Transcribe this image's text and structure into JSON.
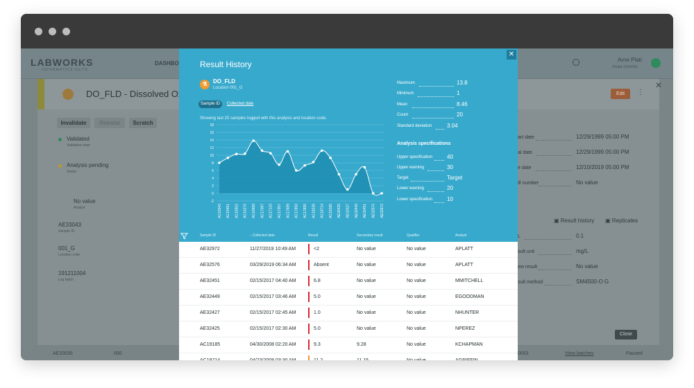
{
  "background_app": {
    "logo": "LABWORKS",
    "logo_sub": "INFORMATICS SUITE",
    "nav_item": "DASHBOA",
    "user_name": "Arne Platt",
    "user_role": "Head chemist",
    "panel_title": "DO_FLD - Dissolved Oxygen",
    "edit_label": "Edit",
    "buttons": [
      "Invalidate",
      "Reinstat",
      "Scratch"
    ],
    "left_fields": [
      {
        "value": "Validated",
        "label": "Validation state"
      },
      {
        "value": "Analysis pending",
        "label": "Status"
      },
      {
        "value": "No value",
        "label": "Analyst"
      },
      {
        "value": "AE33043",
        "label": "Sample ID"
      },
      {
        "value": "001_G",
        "label": "Location code"
      },
      {
        "value": "191211004",
        "label": "Log batch"
      }
    ],
    "right_fields": [
      {
        "label": "art date",
        "value": "12/29/1999 05:00 PM"
      },
      {
        "label": "al date",
        "value": "12/29/1999 05:00 PM"
      },
      {
        "label": "e date",
        "value": "12/10/2019 05:00 PM"
      },
      {
        "label": "ill number",
        "value": "No value"
      }
    ],
    "links": [
      "Result history",
      "Replicates"
    ],
    "right_fields_2": [
      {
        "label": "L",
        "value": "0.1"
      },
      {
        "label": "sult unit",
        "value": "mg/L"
      },
      {
        "label": "ew result",
        "value": "No value"
      },
      {
        "label": "sult method",
        "value": "SM4500-O G"
      }
    ],
    "close_label": "Close",
    "footer": [
      "AE33035",
      "000",
      "0003",
      "View batches",
      "Paused"
    ]
  },
  "modal": {
    "title": "Result History",
    "close_icon": "close-icon",
    "analysis_code": "DO_FLD",
    "location": "Location 001_G",
    "tabs": [
      "Sample ID",
      "Collected date"
    ],
    "showing_text": "Showing last 20 samples logged with this analysis and location code.",
    "stats": [
      {
        "label": "Maximum",
        "value": "13.8"
      },
      {
        "label": "Minimum",
        "value": "1"
      },
      {
        "label": "Mean",
        "value": "8.46"
      },
      {
        "label": "Count",
        "value": "20"
      },
      {
        "label": "Standard deviation",
        "value": "3.04"
      }
    ],
    "spec_title": "Analysis specifications",
    "specs": [
      {
        "label": "Upper specification",
        "value": "40"
      },
      {
        "label": "Upper warning",
        "value": "30"
      },
      {
        "label": "Target",
        "value": "Target"
      },
      {
        "label": "Lower warning",
        "value": "20"
      },
      {
        "label": "Lower specification",
        "value": "10"
      }
    ],
    "table_headers": [
      "Sample ID",
      "Collected date",
      "Result",
      "Secondary result",
      "Qualifier",
      "Analyst"
    ],
    "rows": [
      [
        "AE32972",
        "11/27/2019 10:49 AM",
        "<2",
        "No value",
        "No value",
        "APLATT"
      ],
      [
        "AE32576",
        "03/29/2019 06:34 AM",
        "Absent",
        "No value",
        "No value",
        "APLATT"
      ],
      [
        "AE32451",
        "02/15/2017 04:40 AM",
        "6.8",
        "No value",
        "No value",
        "MMITCHELL"
      ],
      [
        "AE32449",
        "02/15/2017 03:46 AM",
        "5.0",
        "No value",
        "No value",
        "EGOODMAN"
      ],
      [
        "AE32427",
        "02/15/2017 02:45 AM",
        "1.0",
        "No value",
        "No value",
        "NHUNTER"
      ],
      [
        "AE32425",
        "02/15/2017 02:30 AM",
        "5.0",
        "No value",
        "No value",
        "NPEREZ"
      ],
      [
        "AC19185",
        "04/30/2008 02:20 AM",
        "9.3",
        "9.28",
        "No value",
        "KCHAPMAN"
      ],
      [
        "AC18714",
        "04/23/2008 03:30 AM",
        "11.2",
        "11.15",
        "No value",
        "AGRIFFIN"
      ]
    ]
  },
  "chart_data": {
    "type": "area",
    "categories": [
      "AC15043",
      "AC15451",
      "AC15902",
      "AC16276",
      "AC16999",
      "AC17097",
      "AC17133",
      "AC17357",
      "AC17689",
      "AC17893",
      "AC17895",
      "AC18238",
      "AC18714",
      "AC19185",
      "AE32425",
      "AE32427",
      "AE32449",
      "AE32451",
      "AE32576",
      "AE32972"
    ],
    "values": [
      8,
      9.3,
      10.3,
      10.4,
      13.8,
      11.2,
      10.5,
      7.5,
      11,
      6,
      7.3,
      8.2,
      11.2,
      9.3,
      5,
      1,
      5,
      6.8,
      0,
      0
    ],
    "ylim": [
      -2,
      18
    ],
    "yticks": [
      -2,
      0,
      2,
      4,
      6,
      8,
      10,
      12,
      14,
      16,
      18
    ],
    "grid": true,
    "colors": {
      "fill": "#1f8fb3",
      "line": "#ffffff"
    }
  }
}
